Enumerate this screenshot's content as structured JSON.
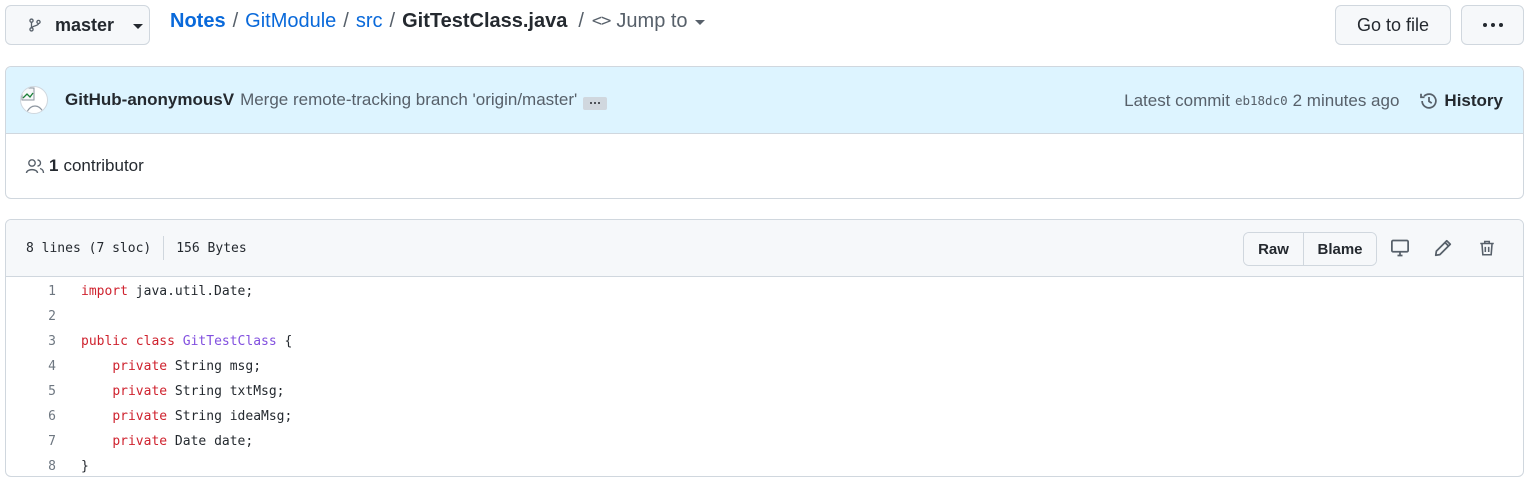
{
  "branch": {
    "label": "master",
    "icon": "git-branch-icon"
  },
  "breadcrumb": {
    "root": "Notes",
    "parts": [
      "GitModule",
      "src"
    ],
    "file": "GitTestClass.java",
    "separator": "/",
    "jump_label": "Jump to",
    "jump_icon": "<>"
  },
  "goto_file_label": "Go to file",
  "commit": {
    "author": "GitHub-anonymousV",
    "message": "Merge remote-tracking branch 'origin/master'",
    "latest_label": "Latest commit",
    "sha": "eb18dc0",
    "time": "2 minutes ago",
    "history_label": "History"
  },
  "contributors": {
    "count": "1",
    "label": "contributor"
  },
  "file_info": {
    "lines": "8 lines (7 sloc)",
    "size": "156 Bytes",
    "raw_label": "Raw",
    "blame_label": "Blame"
  },
  "colors": {
    "link": "#0969da",
    "keyword": "#cf222e",
    "class_name": "#8250df",
    "commit_bg": "#ddf4ff",
    "border": "#d0d7de"
  },
  "code_lines": [
    {
      "num": "1",
      "tokens": [
        {
          "t": "import",
          "k": "kw"
        },
        {
          "t": " java.util.Date;",
          "k": ""
        }
      ]
    },
    {
      "num": "2",
      "tokens": []
    },
    {
      "num": "3",
      "tokens": [
        {
          "t": "public",
          "k": "kw"
        },
        {
          "t": " ",
          "k": ""
        },
        {
          "t": "class",
          "k": "kw"
        },
        {
          "t": " ",
          "k": ""
        },
        {
          "t": "GitTestClass",
          "k": "cls"
        },
        {
          "t": " {",
          "k": ""
        }
      ]
    },
    {
      "num": "4",
      "tokens": [
        {
          "t": "    ",
          "k": ""
        },
        {
          "t": "private",
          "k": "kw"
        },
        {
          "t": " String msg;",
          "k": ""
        }
      ]
    },
    {
      "num": "5",
      "tokens": [
        {
          "t": "    ",
          "k": ""
        },
        {
          "t": "private",
          "k": "kw"
        },
        {
          "t": " String txtMsg;",
          "k": ""
        }
      ]
    },
    {
      "num": "6",
      "tokens": [
        {
          "t": "    ",
          "k": ""
        },
        {
          "t": "private",
          "k": "kw"
        },
        {
          "t": " String ideaMsg;",
          "k": ""
        }
      ]
    },
    {
      "num": "7",
      "tokens": [
        {
          "t": "    ",
          "k": ""
        },
        {
          "t": "private",
          "k": "kw"
        },
        {
          "t": " Date date;",
          "k": ""
        }
      ]
    },
    {
      "num": "8",
      "tokens": [
        {
          "t": "}",
          "k": ""
        }
      ]
    }
  ]
}
